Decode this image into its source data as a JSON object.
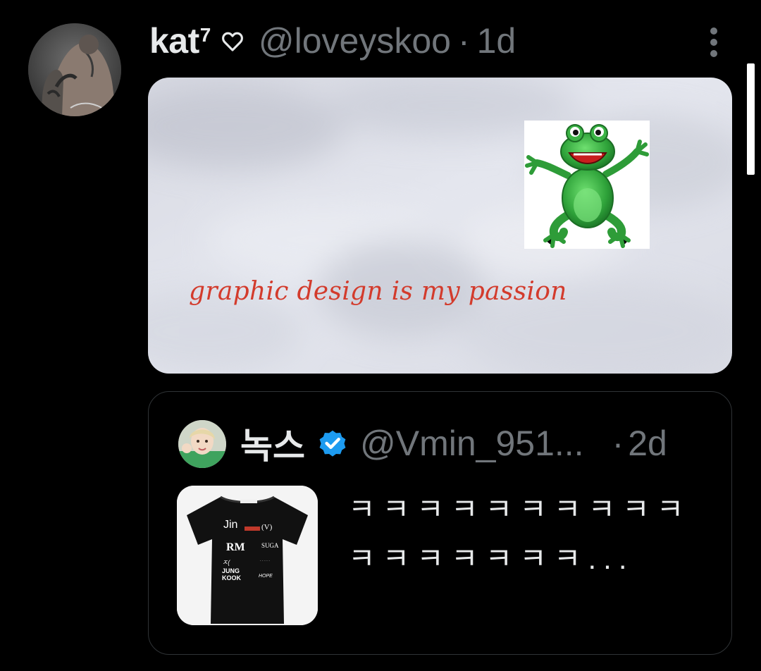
{
  "post": {
    "display_name": "kat",
    "name_superscript": "7",
    "name_emoji_icon": "heart-outline-icon",
    "handle": "@loveyskoo",
    "separator": "·",
    "time": "1d",
    "more_icon": "more-vertical-icon"
  },
  "media": {
    "caption": "graphic design is my passion",
    "caption_color": "#d33b2c",
    "image_subject": "green cartoon frog on cloudy sky"
  },
  "quote": {
    "display_name": "녹스",
    "verified_icon": "verified-badge-icon",
    "verified_color": "#1d9bf0",
    "handle": "@Vmin_951...",
    "separator": "·",
    "time": "2d",
    "text": "ㅋㅋㅋㅋㅋㅋㅋㅋㅋㅋㅋㅋㅋㅋㅋㅋㅋ...",
    "thumbnail_labels": {
      "jin": "Jin",
      "rm": "RM",
      "suga": "SUGA",
      "jungkook": "JUNG\nKOOK"
    }
  },
  "colors": {
    "background": "#000000",
    "primary_text": "#e7e9ea",
    "secondary_text": "#71767b",
    "border": "#2f3336"
  }
}
